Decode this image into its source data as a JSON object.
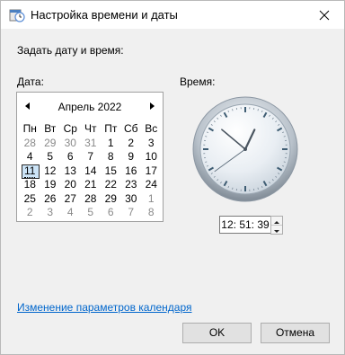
{
  "window": {
    "title": "Настройка времени и даты"
  },
  "section": {
    "heading": "Задать дату и время:"
  },
  "date": {
    "label": "Дата:",
    "month_label": "Апрель 2022",
    "weekdays": [
      "Пн",
      "Вт",
      "Ср",
      "Чт",
      "Пт",
      "Сб",
      "Вс"
    ],
    "weeks": [
      [
        "28",
        "29",
        "30",
        "31",
        "1",
        "2",
        "3"
      ],
      [
        "4",
        "5",
        "6",
        "7",
        "8",
        "9",
        "10"
      ],
      [
        "11",
        "12",
        "13",
        "14",
        "15",
        "16",
        "17"
      ],
      [
        "18",
        "19",
        "20",
        "21",
        "22",
        "23",
        "24"
      ],
      [
        "25",
        "26",
        "27",
        "28",
        "29",
        "30",
        "1"
      ],
      [
        "2",
        "3",
        "4",
        "5",
        "6",
        "7",
        "8"
      ]
    ],
    "selected_day": "11"
  },
  "time": {
    "label": "Время:",
    "value": "12: 51: 39",
    "hours": 12,
    "minutes": 51,
    "seconds": 39
  },
  "link": {
    "calendar_settings": "Изменение параметров календаря"
  },
  "buttons": {
    "ok": "OK",
    "cancel": "Отмена"
  }
}
